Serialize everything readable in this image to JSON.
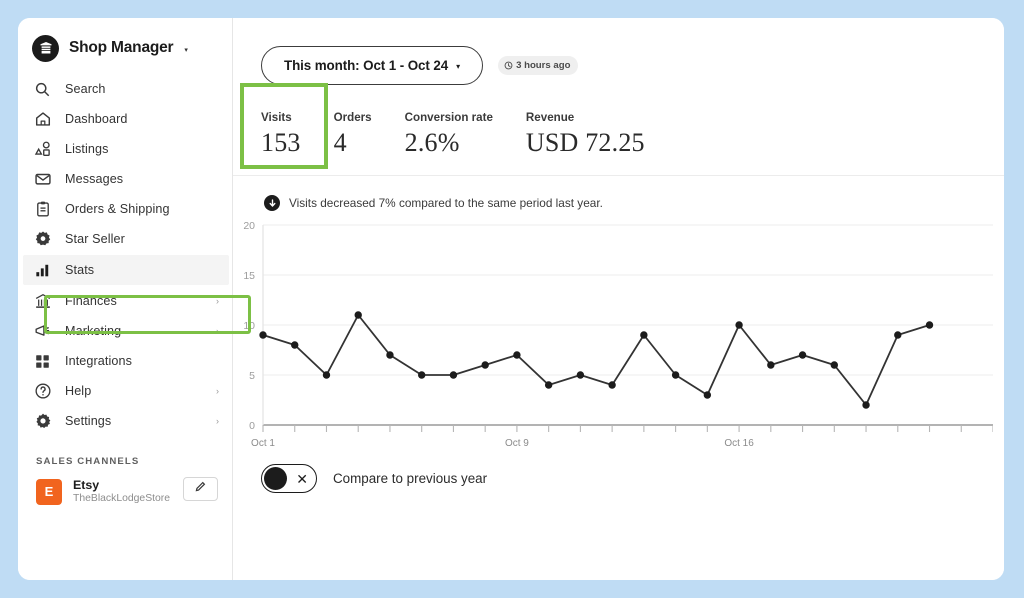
{
  "window": {
    "background_color": "#bfdcf4",
    "card_color": "#ffffff"
  },
  "accents": {
    "highlight_green": "#7cc045",
    "etsy_orange": "#f1641e",
    "line_color": "#333333"
  },
  "sidebar": {
    "shop": {
      "title": "Shop Manager",
      "caret": "▾",
      "logo_icon": "storefront-icon"
    },
    "items": [
      {
        "label": "Search",
        "icon": "search-icon",
        "chevron": false,
        "highlighted": false
      },
      {
        "label": "Dashboard",
        "icon": "home-icon",
        "chevron": false,
        "highlighted": false
      },
      {
        "label": "Listings",
        "icon": "listings-icon",
        "chevron": false,
        "highlighted": false
      },
      {
        "label": "Messages",
        "icon": "envelope-icon",
        "chevron": false,
        "highlighted": false
      },
      {
        "label": "Orders & Shipping",
        "icon": "clipboard-icon",
        "chevron": false,
        "highlighted": false
      },
      {
        "label": "Star Seller",
        "icon": "star-badge-icon",
        "chevron": false,
        "highlighted": false
      },
      {
        "label": "Stats",
        "icon": "bar-chart-icon",
        "chevron": false,
        "highlighted": true
      },
      {
        "label": "Finances",
        "icon": "bank-icon",
        "chevron": true,
        "highlighted": false
      },
      {
        "label": "Marketing",
        "icon": "megaphone-icon",
        "chevron": true,
        "highlighted": false
      },
      {
        "label": "Integrations",
        "icon": "grid-squares-icon",
        "chevron": false,
        "highlighted": false
      },
      {
        "label": "Help",
        "icon": "question-mark-icon",
        "chevron": true,
        "highlighted": false
      },
      {
        "label": "Settings",
        "icon": "gear-icon",
        "chevron": true,
        "highlighted": false
      }
    ],
    "sales_channels": {
      "heading": "SALES CHANNELS",
      "channel": {
        "badge_letter": "E",
        "name": "Etsy",
        "store": "TheBlackLodgeStore",
        "edit_icon": "pencil-icon"
      }
    }
  },
  "main": {
    "date_range": {
      "label": "This month: Oct 1 - Oct 24",
      "caret": "▾"
    },
    "refresh": {
      "icon": "clock-icon",
      "text": "3 hours ago"
    },
    "kpis": [
      {
        "label": "Visits",
        "value": "153",
        "selected": true
      },
      {
        "label": "Orders",
        "value": "4",
        "selected": false
      },
      {
        "label": "Conversion rate",
        "value": "2.6%",
        "selected": false
      },
      {
        "label": "Revenue",
        "value": "USD 72.25",
        "selected": false
      }
    ],
    "note": {
      "icon": "arrow-down-circle-icon",
      "text": "Visits decreased 7% compared to the same period last year."
    },
    "compare_toggle": {
      "label": "Compare to previous year",
      "state": "off",
      "off_icon": "close-x-icon"
    }
  },
  "chart_data": {
    "type": "line",
    "title": "",
    "xlabel": "",
    "ylabel": "",
    "ylim": [
      0,
      20
    ],
    "yticks": [
      0,
      5,
      10,
      15,
      20
    ],
    "grid": true,
    "gridlines_at": [
      5,
      10,
      15,
      20
    ],
    "legend": "none",
    "x": [
      "Oct 1",
      "Oct 2",
      "Oct 3",
      "Oct 4",
      "Oct 5",
      "Oct 6",
      "Oct 7",
      "Oct 8",
      "Oct 9",
      "Oct 10",
      "Oct 11",
      "Oct 12",
      "Oct 13",
      "Oct 14",
      "Oct 15",
      "Oct 16",
      "Oct 17",
      "Oct 18",
      "Oct 19",
      "Oct 20",
      "Oct 21",
      "Oct 22",
      "Oct 23",
      "Oct 24"
    ],
    "xtick_labels": [
      "Oct 1",
      "Oct 9",
      "Oct 16"
    ],
    "xtick_indices": [
      0,
      8,
      15
    ],
    "values": [
      9,
      8,
      5,
      11,
      7,
      5,
      5,
      6,
      7,
      4,
      5,
      4,
      9,
      5,
      3,
      10,
      6,
      7,
      6,
      2,
      9,
      10,
      null,
      null
    ],
    "series": [
      {
        "name": "Visits",
        "color": "#333333",
        "values": [
          9,
          8,
          5,
          11,
          7,
          5,
          5,
          6,
          7,
          4,
          5,
          4,
          9,
          5,
          3,
          10,
          6,
          7,
          6,
          2,
          9,
          10
        ]
      }
    ]
  }
}
